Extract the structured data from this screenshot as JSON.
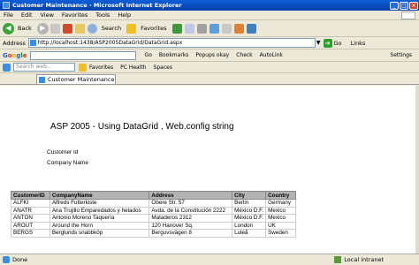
{
  "window": {
    "title": "Customer Maintenance - Microsoft Internet Explorer"
  },
  "menu": [
    "File",
    "Edit",
    "View",
    "Favorites",
    "Tools",
    "Help"
  ],
  "toolbar": {
    "back": "Back",
    "search": "Search",
    "favorites": "Favorites"
  },
  "address": {
    "label": "Address",
    "url": "http://localhost:1438/ASP2005DataGrid/DataGrid.aspx",
    "go": "Go",
    "links": "Links"
  },
  "google": {
    "logo": "Google",
    "go": "Go",
    "bookmarks": "Bookmarks",
    "popups": "Popups okay",
    "check": "Check",
    "autolink": "AutoLink",
    "settings": "Settings"
  },
  "live": {
    "placeholder": "Search web...",
    "favorites": "Favorites",
    "pc_health": "PC Health",
    "spaces": "Spaces"
  },
  "tab": {
    "label": "Customer Maintenance"
  },
  "page": {
    "heading": "ASP 2005 - Using DataGrid , Web.config string",
    "customer_id_label": "Customer Id",
    "company_name_label": "Company Name"
  },
  "grid": {
    "headers": [
      "CustomerID",
      "CompanyName",
      "Address",
      "City",
      "Country"
    ],
    "rows": [
      [
        "ALFKI",
        "Alfreds Futterkiste",
        "Obere Str. 57",
        "Berlin",
        "Germany"
      ],
      [
        "ANATR",
        "Ana Trujillo Emparedados y helados",
        "Avda. de la Constitución 2222",
        "México D.F.",
        "Mexico"
      ],
      [
        "ANTON",
        "Antonio Moreno Taquería",
        "Mataderos 2312",
        "México D.F.",
        "Mexico"
      ],
      [
        "AROUT",
        "Around the Horn",
        "120 Hanover Sq.",
        "London",
        "UK"
      ],
      [
        "BERGS",
        "Berglunds snabbköp",
        "Berguvsvägen 8",
        "Luleå",
        "Sweden"
      ]
    ]
  },
  "status": {
    "text": "Done",
    "zone": "Local intranet"
  }
}
